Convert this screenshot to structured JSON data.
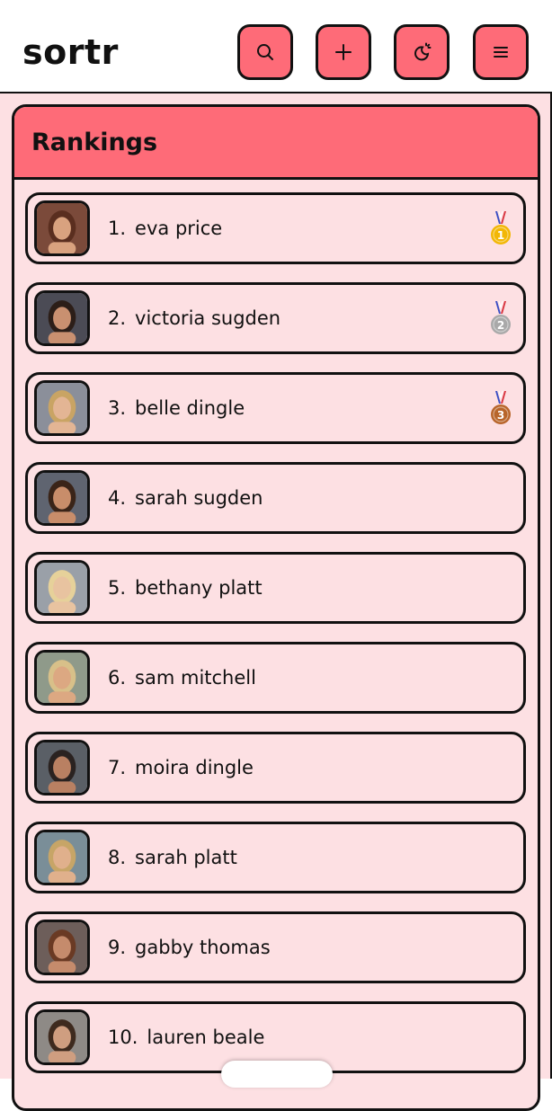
{
  "app": {
    "title": "sortr"
  },
  "header": {
    "buttons": [
      {
        "name": "search-button",
        "icon": "search-icon"
      },
      {
        "name": "add-button",
        "icon": "plus-icon"
      },
      {
        "name": "theme-button",
        "icon": "theme-toggle-icon"
      },
      {
        "name": "menu-button",
        "icon": "hamburger-menu-icon"
      }
    ]
  },
  "rankings": {
    "title": "Rankings",
    "items": [
      {
        "rank": "1.",
        "name": "eva price",
        "medal": "gold",
        "medal_label": "1"
      },
      {
        "rank": "2.",
        "name": "victoria sugden",
        "medal": "silver",
        "medal_label": "2"
      },
      {
        "rank": "3.",
        "name": "belle dingle",
        "medal": "bronze",
        "medal_label": "3"
      },
      {
        "rank": "4.",
        "name": "sarah sugden"
      },
      {
        "rank": "5.",
        "name": "bethany platt"
      },
      {
        "rank": "6.",
        "name": "sam mitchell"
      },
      {
        "rank": "7.",
        "name": "moira dingle"
      },
      {
        "rank": "8.",
        "name": "sarah platt"
      },
      {
        "rank": "9.",
        "name": "gabby thomas"
      },
      {
        "rank": "10.",
        "name": "lauren beale"
      }
    ]
  },
  "colors": {
    "accent": "#fe6b78",
    "background": "#fde0e3",
    "border": "#111111",
    "gold": "#f2b705",
    "silver": "#a9a9a9",
    "bronze": "#b8652a"
  }
}
